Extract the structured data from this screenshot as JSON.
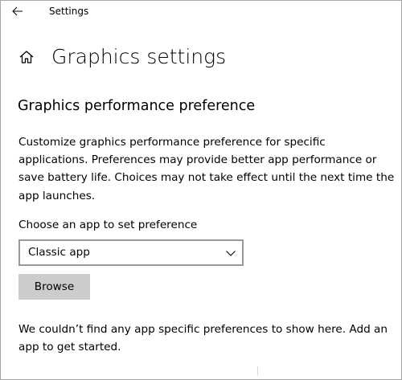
{
  "window": {
    "title": "Settings"
  },
  "header": {
    "home_icon": "home-icon",
    "back_icon": "back-arrow-icon",
    "page_title": "Graphics settings"
  },
  "section": {
    "title": "Graphics performance preference",
    "description": "Customize graphics performance preference for specific applications. Preferences may provide better app performance or save battery life. Choices may not take effect until the next time the app launches."
  },
  "app_picker": {
    "label": "Choose an app to set preference",
    "selected": "Classic app",
    "browse_label": "Browse"
  },
  "empty_state": {
    "message": "We couldn’t find any app specific preferences to show here. Add an app to get started."
  },
  "colors": {
    "background": "#ffffff",
    "button_bg": "#cccccc",
    "dropdown_border": "#999999",
    "window_border": "#a6a6a6",
    "text": "#000000"
  }
}
